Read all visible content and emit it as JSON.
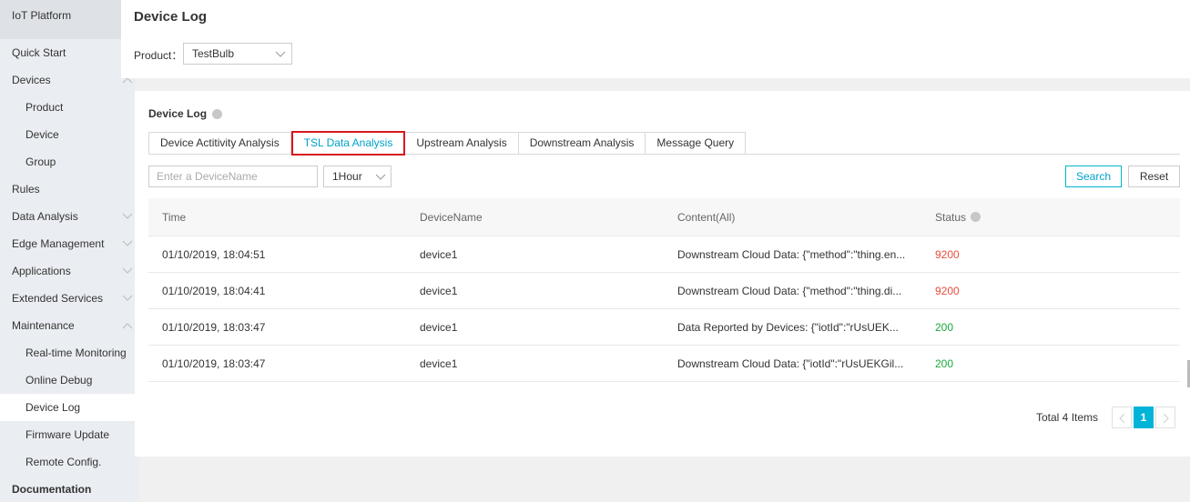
{
  "sidebar": {
    "app_title": "IoT Platform",
    "items": [
      {
        "label": "Quick Start"
      },
      {
        "label": "Devices"
      },
      {
        "label": "Product"
      },
      {
        "label": "Device"
      },
      {
        "label": "Group"
      },
      {
        "label": "Rules"
      },
      {
        "label": "Data Analysis"
      },
      {
        "label": "Edge Management"
      },
      {
        "label": "Applications"
      },
      {
        "label": "Extended Services"
      },
      {
        "label": "Maintenance"
      },
      {
        "label": "Real-time Monitoring"
      },
      {
        "label": "Online Debug"
      },
      {
        "label": "Device Log"
      },
      {
        "label": "Firmware Update"
      },
      {
        "label": "Remote Config."
      },
      {
        "label": "Documentation"
      }
    ]
  },
  "header": {
    "title": "Device Log",
    "product_label": "Product：",
    "product_value": "TestBulb"
  },
  "main": {
    "section_title": "Device Log",
    "tabs": [
      {
        "label": "Device Actitivity Analysis"
      },
      {
        "label": "TSL Data Analysis"
      },
      {
        "label": "Upstream Analysis"
      },
      {
        "label": "Downstream Analysis"
      },
      {
        "label": "Message Query"
      }
    ],
    "active_tab": "TSL Data Analysis",
    "filter": {
      "device_placeholder": "Enter a DeviceName",
      "time_value": "1Hour",
      "search_label": "Search",
      "reset_label": "Reset"
    },
    "table": {
      "headers": [
        "Time",
        "DeviceName",
        "Content(All)",
        "Status"
      ],
      "rows": [
        {
          "time": "01/10/2019, 18:04:51",
          "device": "device1",
          "content": "Downstream Cloud Data: {\"method\":\"thing.en...",
          "status": "9200"
        },
        {
          "time": "01/10/2019, 18:04:41",
          "device": "device1",
          "content": "Downstream Cloud Data: {\"method\":\"thing.di...",
          "status": "9200"
        },
        {
          "time": "01/10/2019, 18:03:47",
          "device": "device1",
          "content": "Data Reported by Devices: {\"iotId\":\"rUsUEK...",
          "status": "200"
        },
        {
          "time": "01/10/2019, 18:03:47",
          "device": "device1",
          "content": "Downstream Cloud Data: {\"iotId\":\"rUsUEKGil...",
          "status": "200"
        }
      ]
    },
    "pagination": {
      "total_text": "Total 4 Items",
      "current_page": "1"
    }
  },
  "colors": {
    "accent": "#00a2ca",
    "status_error": "#e84c3d",
    "status_ok": "#1aaa3c",
    "highlight_border": "#d7191d"
  }
}
